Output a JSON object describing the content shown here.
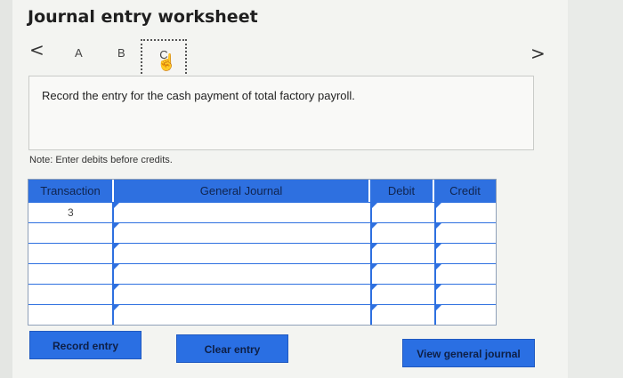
{
  "header": {
    "title": "Journal entry worksheet"
  },
  "nav": {
    "prev_symbol": "<",
    "next_symbol": ">",
    "tabs": [
      {
        "label": "A"
      },
      {
        "label": "B"
      },
      {
        "label": "C",
        "active": true
      }
    ]
  },
  "prompt": {
    "text": "Record the entry for the cash payment of total factory payroll."
  },
  "note": {
    "text": "Note: Enter debits before credits."
  },
  "table": {
    "columns": [
      "Transaction",
      "General Journal",
      "Debit",
      "Credit"
    ],
    "rows": [
      {
        "transaction": "3",
        "account": "",
        "debit": "",
        "credit": ""
      },
      {
        "transaction": "",
        "account": "",
        "debit": "",
        "credit": ""
      },
      {
        "transaction": "",
        "account": "",
        "debit": "",
        "credit": ""
      },
      {
        "transaction": "",
        "account": "",
        "debit": "",
        "credit": ""
      },
      {
        "transaction": "",
        "account": "",
        "debit": "",
        "credit": ""
      },
      {
        "transaction": "",
        "account": "",
        "debit": "",
        "credit": ""
      }
    ]
  },
  "buttons": {
    "record": "Record entry",
    "clear": "Clear entry",
    "view": "View general journal"
  },
  "colors": {
    "accent": "#2e70e0"
  }
}
